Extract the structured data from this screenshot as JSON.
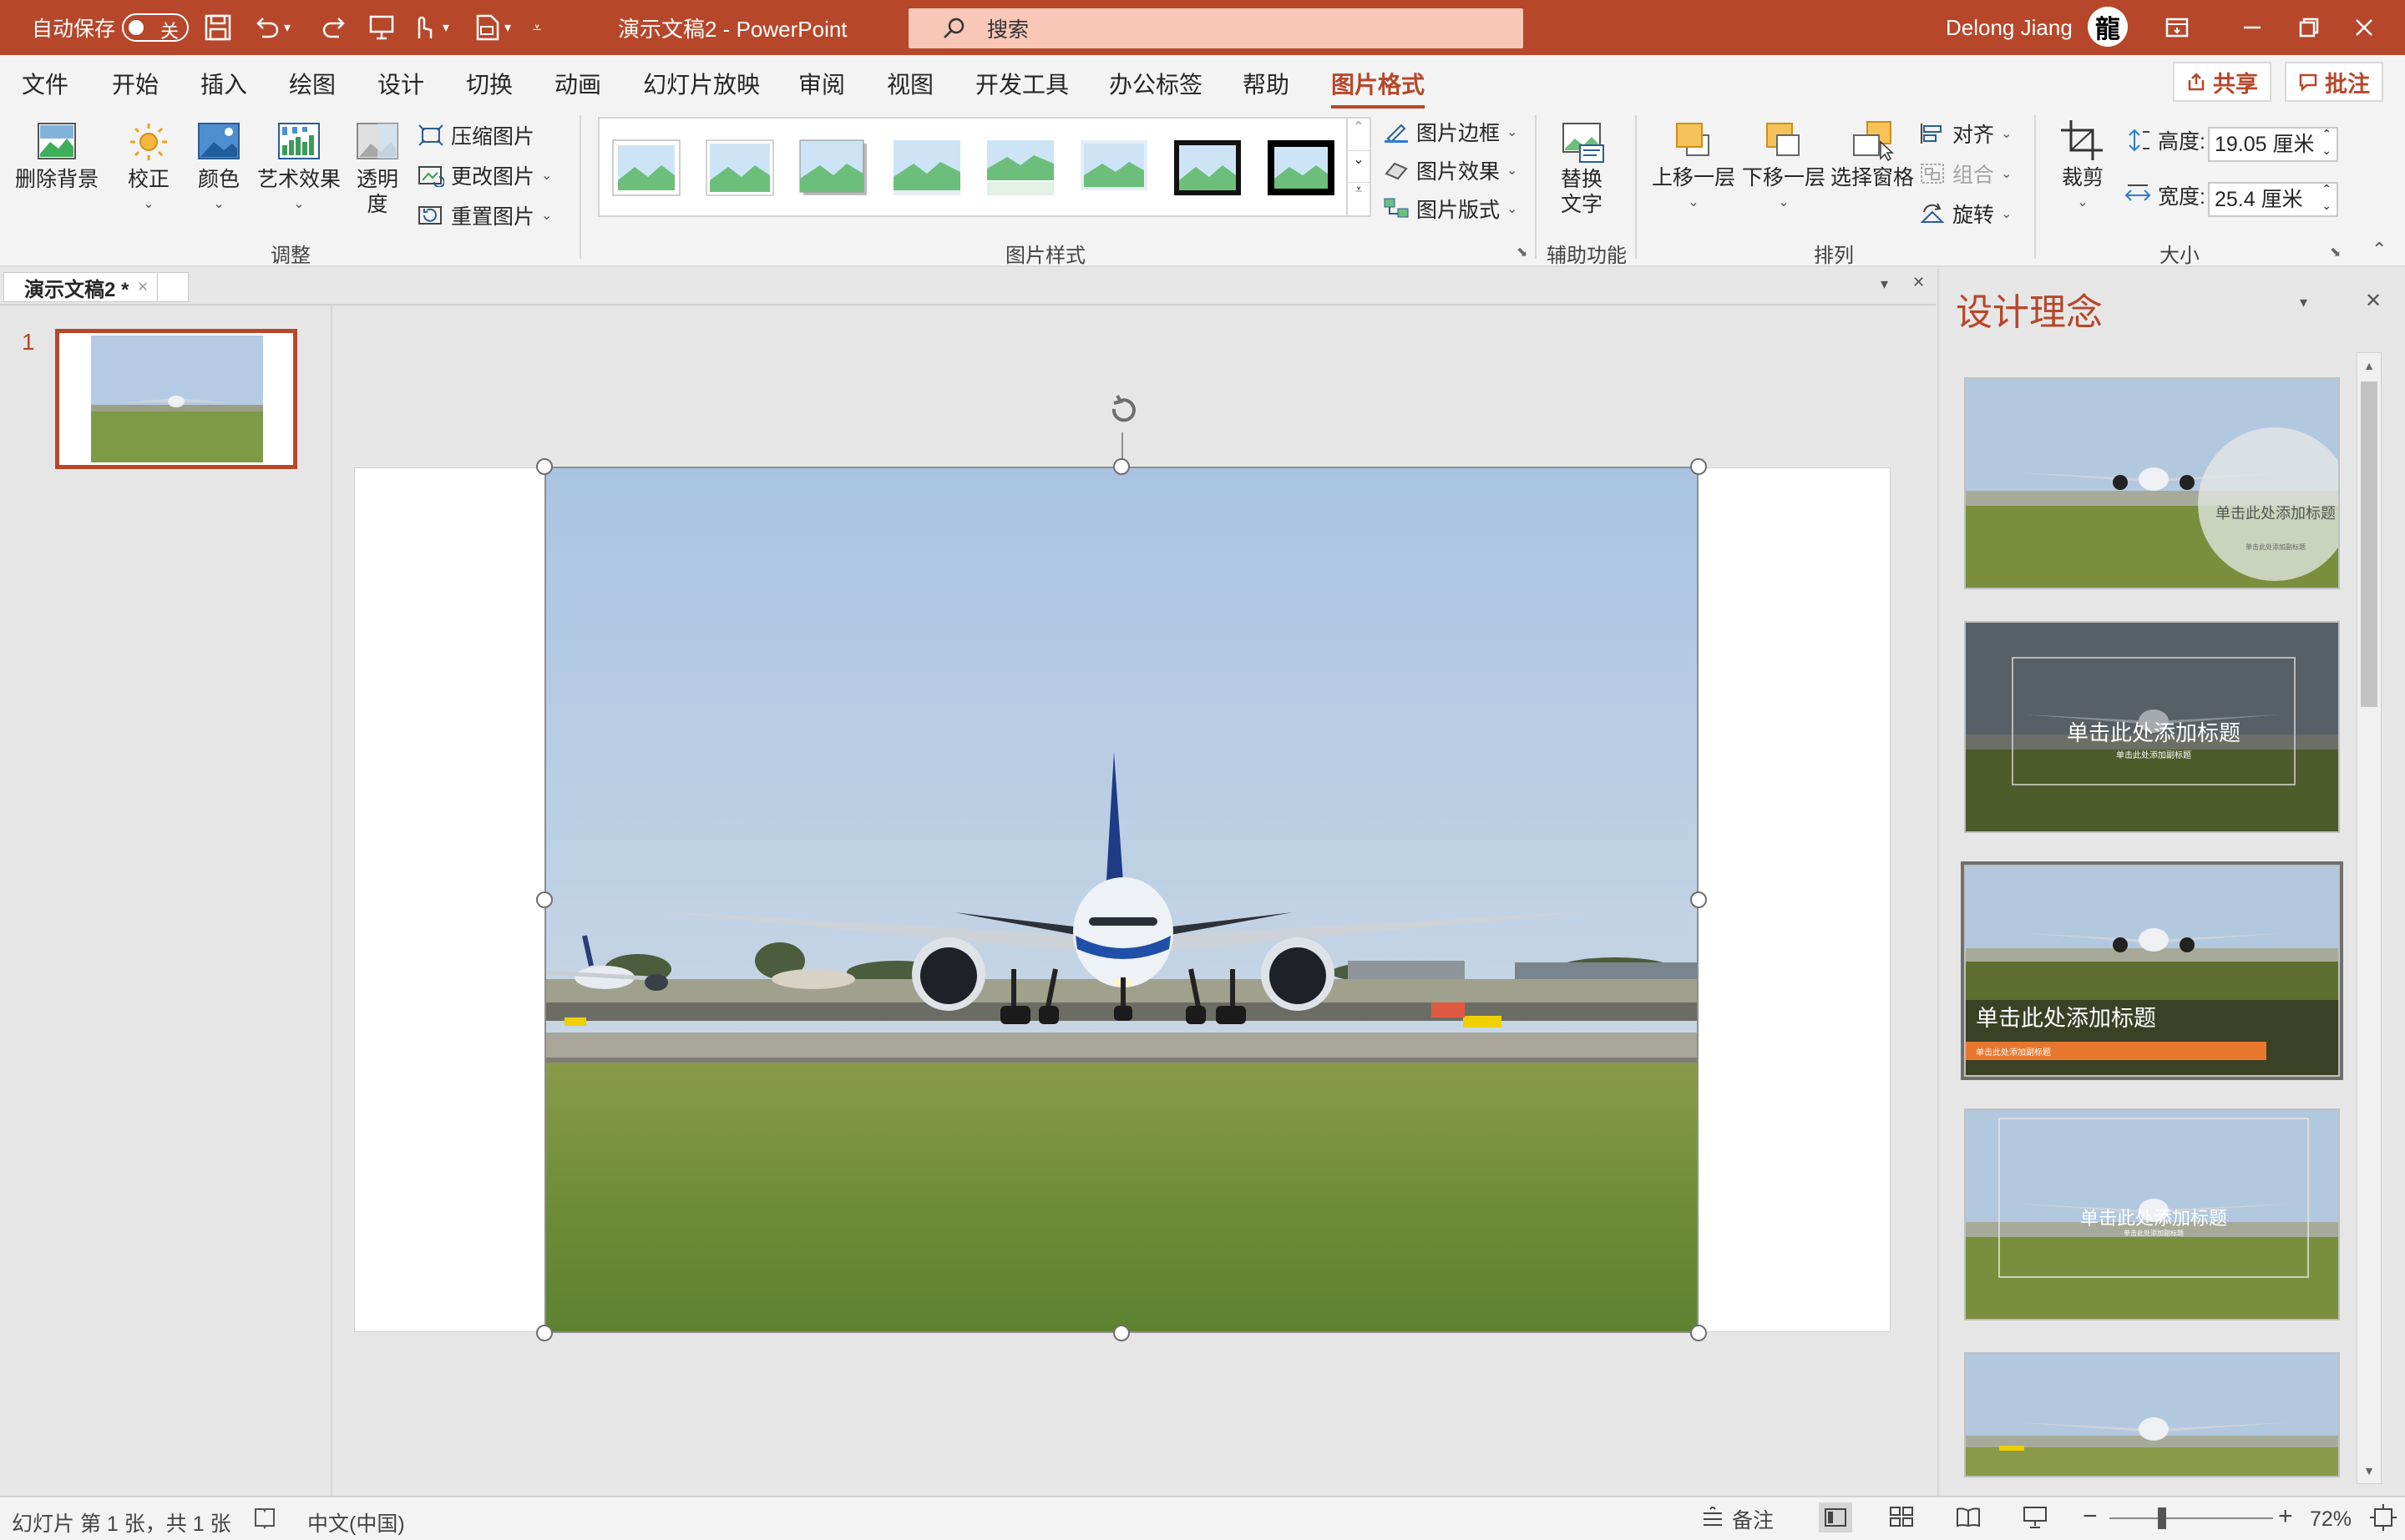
{
  "titlebar": {
    "autosave_label": "自动保存",
    "autosave_state": "关",
    "doc_title": "演示文稿2  -  PowerPoint",
    "search_placeholder": "搜索",
    "user_name": "Delong Jiang",
    "avatar_glyph": "龍"
  },
  "menu": {
    "tabs": [
      "文件",
      "开始",
      "插入",
      "绘图",
      "设计",
      "切换",
      "动画",
      "幻灯片放映",
      "审阅",
      "视图",
      "开发工具",
      "办公标签",
      "帮助",
      "图片格式"
    ],
    "active_tab": "图片格式",
    "share_label": "共享",
    "comment_label": "批注"
  },
  "ribbon": {
    "remove_bg": "删除背景",
    "correct": "校正",
    "color": "颜色",
    "artistic": "艺术效果",
    "transparency": "透明\n度",
    "compress": "压缩图片",
    "change_pic": "更改图片",
    "reset_pic": "重置图片",
    "group_adjust": "调整",
    "group_styles": "图片样式",
    "pic_border": "图片边框",
    "pic_effects": "图片效果",
    "pic_layout": "图片版式",
    "alt_text": "替换\n文字",
    "group_access": "辅助功能",
    "bring_forward": "上移一层",
    "send_backward": "下移一层",
    "selection_pane": "选择窗格",
    "align": "对齐",
    "group": "组合",
    "rotate": "旋转",
    "group_arrange": "排列",
    "crop": "裁剪",
    "height_label": "高度:",
    "height_value": "19.05 厘米",
    "width_label": "宽度:",
    "width_value": "25.4 厘米",
    "group_size": "大小"
  },
  "doc_tab": {
    "name": "演示文稿2 *"
  },
  "thumbs": {
    "slide_number": "1"
  },
  "design_pane": {
    "title": "设计理念",
    "placeholder_title": "单击此处添加标题",
    "placeholder_sub": "单击此处添加副标题"
  },
  "status": {
    "slide_info": "幻灯片 第 1 张，共 1 张",
    "language": "中文(中国)",
    "notes": "备注",
    "zoom": "72%"
  },
  "colors": {
    "accent": "#b7472a",
    "orange": "#e8772e"
  }
}
